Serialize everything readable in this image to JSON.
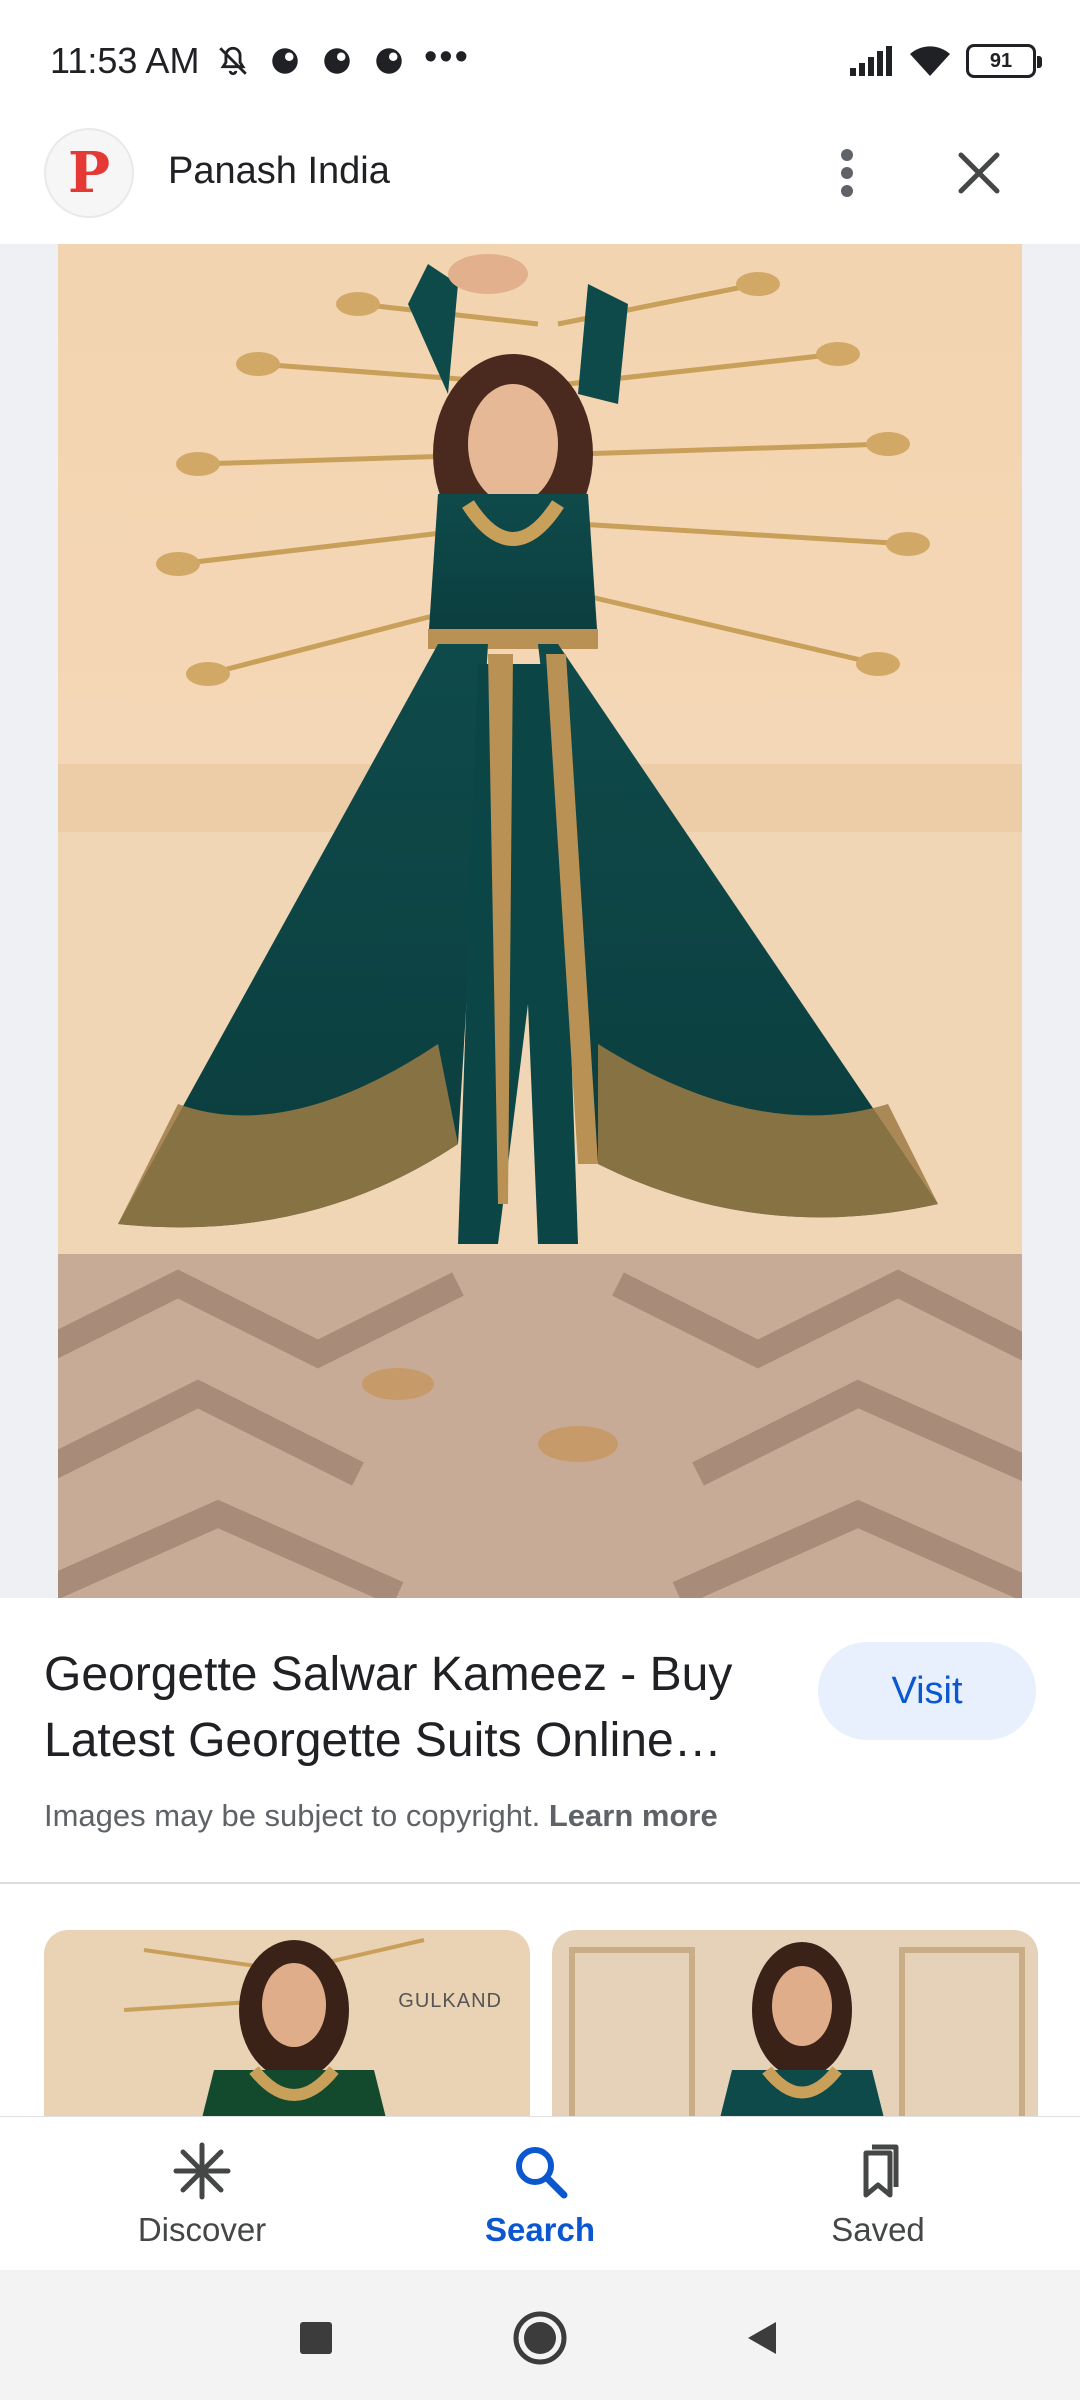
{
  "status_bar": {
    "time": "11:53 AM",
    "left_icons": [
      "bell-off-icon",
      "app-notification-icon",
      "app-notification-icon",
      "app-notification-icon"
    ],
    "more": "•••",
    "battery_level": "91"
  },
  "header": {
    "logo_letter": "P",
    "site_name": "Panash India",
    "brand_color": "#e53935"
  },
  "image": {
    "subject": "woman-in-teal-anarkali"
  },
  "result": {
    "title": "Georgette Salwar Kameez - Buy Latest Georgette Suits Online…",
    "visit_label": "Visit",
    "copyright_text": "Images may be subject to copyright.",
    "learn_more": "Learn more"
  },
  "related": {
    "thumb1_brand": "GULKAND"
  },
  "bottom_nav": {
    "items": [
      {
        "label": "Discover",
        "icon": "asterisk-icon",
        "active": false
      },
      {
        "label": "Search",
        "icon": "search-icon",
        "active": true
      },
      {
        "label": "Saved",
        "icon": "bookmark-icon",
        "active": false
      }
    ],
    "active_color": "#0b57d0"
  }
}
